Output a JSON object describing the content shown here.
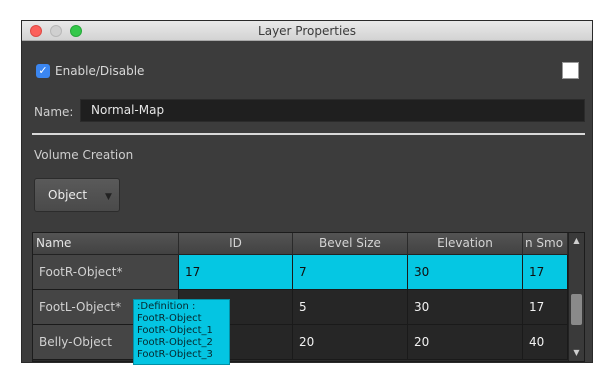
{
  "window": {
    "title": "Layer Properties"
  },
  "enable": {
    "label": "Enable/Disable",
    "checked": true,
    "check_glyph": "✓"
  },
  "swatch_color": "#ffffff",
  "name_field": {
    "label": "Name:",
    "value": "Normal-Map"
  },
  "volume_creation": {
    "title": "Volume Creation"
  },
  "mode_dropdown": {
    "selected": "Object",
    "arrow_glyph": "▼"
  },
  "table": {
    "columns": [
      "Name",
      "ID",
      "Bevel Size",
      "Elevation",
      "n Smo"
    ],
    "rows": [
      {
        "name": "FootR-Object*",
        "id": "17",
        "bevel": "7",
        "elevation": "30",
        "smooth": "17",
        "selected": true
      },
      {
        "name": "FootL-Object*",
        "id": "",
        "bevel": "5",
        "elevation": "30",
        "smooth": "17",
        "selected": false
      },
      {
        "name": "Belly-Object",
        "id": "",
        "bevel": "20",
        "elevation": "20",
        "smooth": "40",
        "selected": false
      }
    ],
    "scroll_up_glyph": "▲",
    "scroll_down_glyph": "▼"
  },
  "tooltip": {
    "lines": [
      ":Definition :",
      "FootR-Object",
      "FootR-Object_1",
      "FootR-Object_2",
      "FootR-Object_3"
    ]
  },
  "colors": {
    "accent_cyan": "#05c7e3",
    "checkbox_blue": "#3b86f0",
    "panel_bg": "#3c3c3c"
  }
}
